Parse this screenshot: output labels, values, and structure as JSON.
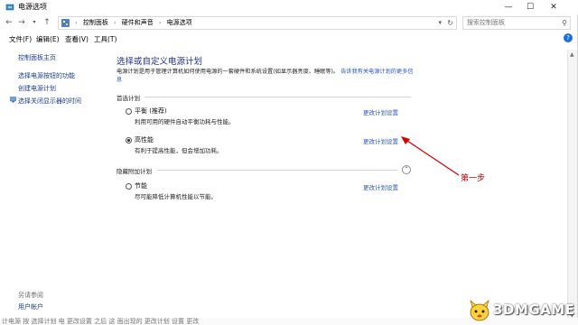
{
  "window": {
    "title": "电源选项",
    "controls": [
      "—",
      "☐",
      "✕"
    ]
  },
  "address": {
    "crumbs": [
      "控制面板",
      "硬件和声音",
      "电源选项"
    ],
    "search_placeholder": "搜索控制面板"
  },
  "menu": [
    "文件(F)",
    "编辑(E)",
    "查看(V)",
    "工具(T)"
  ],
  "sidebar": {
    "home": "控制面板主页",
    "items": [
      "选择电源按钮的功能",
      "创建电源计划",
      "选择关闭显示器的时间"
    ],
    "see_also_title": "另请参阅",
    "see_also_items": [
      "用户帐户"
    ]
  },
  "main": {
    "heading": "选择或自定义电源计划",
    "description": "电源计划是用于管理计算机如何使用电源的一套硬件和系统设置(如显示器亮度、睡眠等)。",
    "description_link": "告诉我有关电源计划的更多信息",
    "preferred_label": "首选计划",
    "hidden_label": "隐藏附加计划",
    "plans": [
      {
        "name": "平衡 (推荐)",
        "desc": "利用可用的硬件自动平衡功耗与性能。",
        "link": "更改计划设置",
        "selected": false
      },
      {
        "name": "高性能",
        "desc": "有利于提高性能，但会增加功耗。",
        "link": "更改计划设置",
        "selected": true
      },
      {
        "name": "节能",
        "desc": "尽可能降低计算机性能以节能。",
        "link": "更改计划设置",
        "selected": false
      }
    ]
  },
  "annotation": {
    "text": "第一步",
    "color": "#d40000"
  },
  "bottom_caption": "计电源 按 选择计划 电 更改设置 之后 这 面出现的 更改计划 设置 更改",
  "watermark": "3DMGAME",
  "colors": {
    "heading": "#1e3287",
    "link": "#2456c4",
    "sidebar_link": "#1a3d8f",
    "arrow": "#d40000"
  }
}
